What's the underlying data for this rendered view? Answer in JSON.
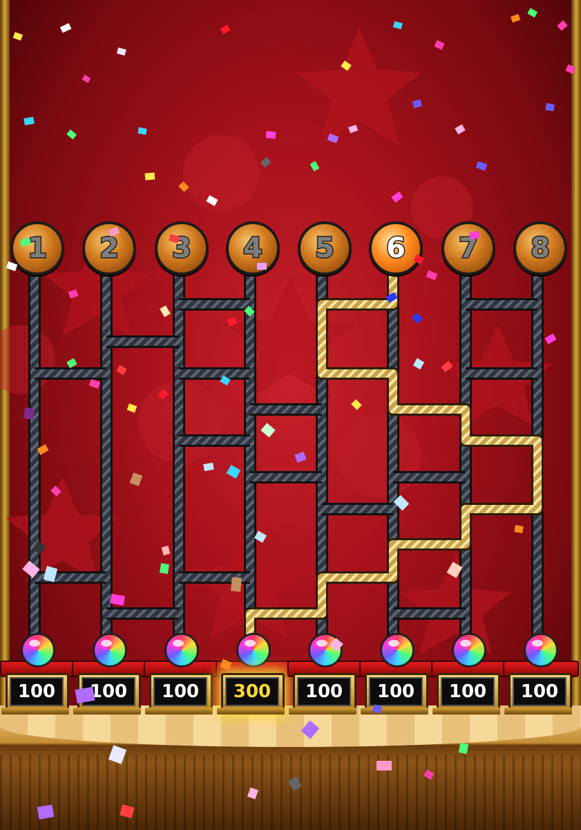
{
  "game": {
    "columns": [
      {
        "number": "1"
      },
      {
        "number": "2"
      },
      {
        "number": "3"
      },
      {
        "number": "4"
      },
      {
        "number": "5"
      },
      {
        "number": "6"
      },
      {
        "number": "7"
      },
      {
        "number": "8"
      }
    ],
    "selected_column": "6",
    "prizes": [
      {
        "label": "100",
        "win": false
      },
      {
        "label": "100",
        "win": false
      },
      {
        "label": "100",
        "win": false
      },
      {
        "label": "300",
        "win": true
      },
      {
        "label": "100",
        "win": false
      },
      {
        "label": "100",
        "win": false
      },
      {
        "label": "100",
        "win": false
      },
      {
        "label": "100",
        "win": false
      }
    ]
  },
  "colors": {
    "rope": "#2e3440",
    "gold_path": "#e8c867",
    "background": "#a8121c",
    "win_text": "#ffd83b"
  }
}
